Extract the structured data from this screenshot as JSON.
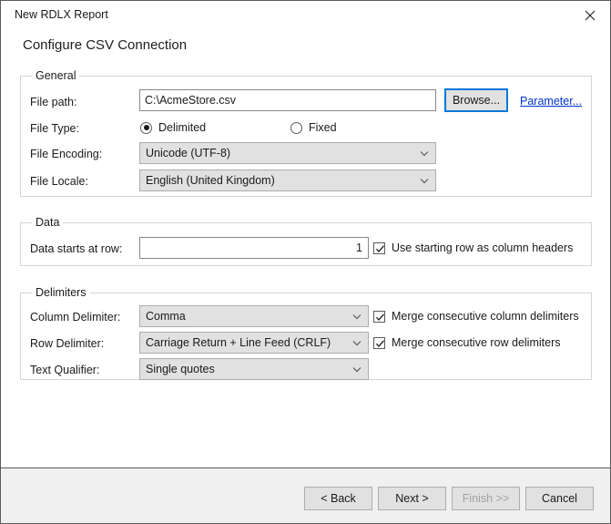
{
  "window": {
    "title": "New RDLX Report",
    "subtitle": "Configure CSV Connection",
    "close_icon": "close-icon"
  },
  "general": {
    "legend": "General",
    "file_path": {
      "label": "File path:",
      "value": "C:\\AcmeStore.csv",
      "placeholder": ""
    },
    "browse_label": "Browse...",
    "parameter_link": "Parameter...",
    "file_type": {
      "label": "File Type:",
      "options": [
        {
          "label": "Delimited",
          "selected": true
        },
        {
          "label": "Fixed",
          "selected": false
        }
      ]
    },
    "file_encoding": {
      "label": "File Encoding:",
      "value": "Unicode (UTF-8)"
    },
    "file_locale": {
      "label": "File Locale:",
      "value": "English (United Kingdom)"
    }
  },
  "data": {
    "legend": "Data",
    "starts_at_row": {
      "label": "Data starts at row:",
      "value": "1"
    },
    "use_starting_row": {
      "label": "Use starting row as column headers",
      "checked": true
    }
  },
  "delimiters": {
    "legend": "Delimiters",
    "column_delimiter": {
      "label": "Column Delimiter:",
      "value": "Comma"
    },
    "row_delimiter": {
      "label": "Row Delimiter:",
      "value": "Carriage Return + Line Feed (CRLF)"
    },
    "text_qualifier": {
      "label": "Text Qualifier:",
      "value": "Single quotes"
    },
    "merge_column": {
      "label": "Merge consecutive column delimiters",
      "checked": true
    },
    "merge_row": {
      "label": "Merge consecutive row delimiters",
      "checked": true
    }
  },
  "footer": {
    "back_label": "< Back",
    "next_label": "Next >",
    "finish_label": "Finish >>",
    "cancel_label": "Cancel"
  },
  "colors": {
    "accent": "#0078d7",
    "link": "#0033cc",
    "control_face": "#e1e1e1",
    "footer_bg": "#f0f0f0",
    "window_border": "#5b5b5b"
  }
}
